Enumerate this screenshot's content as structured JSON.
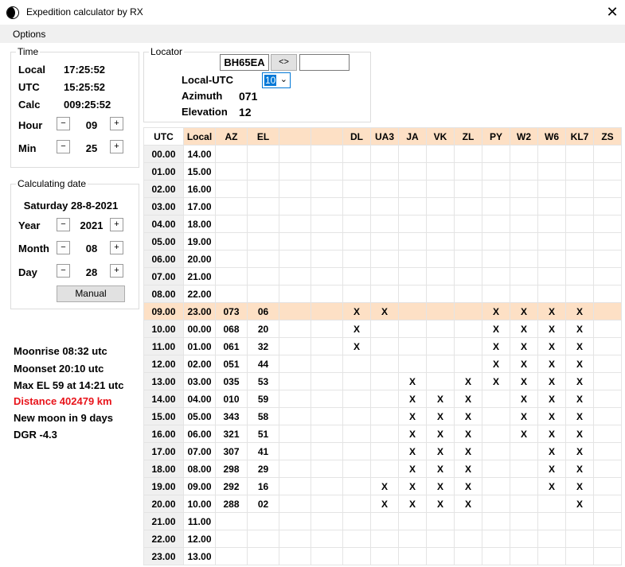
{
  "window": {
    "title": "Expedition calculator by RX",
    "close": "✕"
  },
  "menu": {
    "options": "Options"
  },
  "time": {
    "group_label": "Time",
    "local_label": "Local",
    "local_value": "17:25:52",
    "utc_label": "UTC",
    "utc_value": "15:25:52",
    "calc_label": "Calc",
    "calc_value": "009:25:52",
    "hour_label": "Hour",
    "hour_value": "09",
    "min_label": "Min",
    "min_value": "25"
  },
  "calc_date": {
    "group_label": "Calculating date",
    "date_text": "Saturday 28-8-2021",
    "year_label": "Year",
    "year_value": "2021",
    "month_label": "Month",
    "month_value": "08",
    "day_label": "Day",
    "day_value": "28",
    "manual_button": "Manual"
  },
  "stepper": {
    "minus": "−",
    "plus": "+"
  },
  "locator": {
    "group_label": "Locator",
    "value": "BH65EA",
    "swap_button": "<>",
    "second_value": "",
    "local_utc_label": "Local-UTC",
    "local_utc_value": "10",
    "azimuth_label": "Azimuth",
    "azimuth_value": "071",
    "elevation_label": "Elevation",
    "elevation_value": "12"
  },
  "moon_info": {
    "moonrise": "Moonrise 08:32 utc",
    "moonset": "Moonset 20:10 utc",
    "max_el": "Max EL 59 at 14:21 utc",
    "distance": "Distance 402479 km",
    "new_moon": "New moon in 9 days",
    "dgr": "DGR -4.3"
  },
  "colors": {
    "highlight": "#fde0c5",
    "distance": "#e8141b",
    "select_accent": "#0078d7"
  },
  "table": {
    "headers": [
      "UTC",
      "Local",
      "AZ",
      "EL",
      "",
      "",
      "DL",
      "UA3",
      "JA",
      "VK",
      "ZL",
      "PY",
      "W2",
      "W6",
      "KL7",
      "ZS"
    ],
    "highlight_row": 9,
    "rows": [
      [
        "00.00",
        "14.00",
        "",
        "",
        "",
        "",
        "",
        "",
        "",
        "",
        "",
        "",
        "",
        "",
        "",
        ""
      ],
      [
        "01.00",
        "15.00",
        "",
        "",
        "",
        "",
        "",
        "",
        "",
        "",
        "",
        "",
        "",
        "",
        "",
        ""
      ],
      [
        "02.00",
        "16.00",
        "",
        "",
        "",
        "",
        "",
        "",
        "",
        "",
        "",
        "",
        "",
        "",
        "",
        ""
      ],
      [
        "03.00",
        "17.00",
        "",
        "",
        "",
        "",
        "",
        "",
        "",
        "",
        "",
        "",
        "",
        "",
        "",
        ""
      ],
      [
        "04.00",
        "18.00",
        "",
        "",
        "",
        "",
        "",
        "",
        "",
        "",
        "",
        "",
        "",
        "",
        "",
        ""
      ],
      [
        "05.00",
        "19.00",
        "",
        "",
        "",
        "",
        "",
        "",
        "",
        "",
        "",
        "",
        "",
        "",
        "",
        ""
      ],
      [
        "06.00",
        "20.00",
        "",
        "",
        "",
        "",
        "",
        "",
        "",
        "",
        "",
        "",
        "",
        "",
        "",
        ""
      ],
      [
        "07.00",
        "21.00",
        "",
        "",
        "",
        "",
        "",
        "",
        "",
        "",
        "",
        "",
        "",
        "",
        "",
        ""
      ],
      [
        "08.00",
        "22.00",
        "",
        "",
        "",
        "",
        "",
        "",
        "",
        "",
        "",
        "",
        "",
        "",
        "",
        ""
      ],
      [
        "09.00",
        "23.00",
        "073",
        "06",
        "",
        "",
        "X",
        "X",
        "",
        "",
        "",
        "X",
        "X",
        "X",
        "X",
        ""
      ],
      [
        "10.00",
        "00.00",
        "068",
        "20",
        "",
        "",
        "X",
        "",
        "",
        "",
        "",
        "X",
        "X",
        "X",
        "X",
        ""
      ],
      [
        "11.00",
        "01.00",
        "061",
        "32",
        "",
        "",
        "X",
        "",
        "",
        "",
        "",
        "X",
        "X",
        "X",
        "X",
        ""
      ],
      [
        "12.00",
        "02.00",
        "051",
        "44",
        "",
        "",
        "",
        "",
        "",
        "",
        "",
        "X",
        "X",
        "X",
        "X",
        ""
      ],
      [
        "13.00",
        "03.00",
        "035",
        "53",
        "",
        "",
        "",
        "",
        "X",
        "",
        "X",
        "X",
        "X",
        "X",
        "X",
        ""
      ],
      [
        "14.00",
        "04.00",
        "010",
        "59",
        "",
        "",
        "",
        "",
        "X",
        "X",
        "X",
        "",
        "X",
        "X",
        "X",
        ""
      ],
      [
        "15.00",
        "05.00",
        "343",
        "58",
        "",
        "",
        "",
        "",
        "X",
        "X",
        "X",
        "",
        "X",
        "X",
        "X",
        ""
      ],
      [
        "16.00",
        "06.00",
        "321",
        "51",
        "",
        "",
        "",
        "",
        "X",
        "X",
        "X",
        "",
        "X",
        "X",
        "X",
        ""
      ],
      [
        "17.00",
        "07.00",
        "307",
        "41",
        "",
        "",
        "",
        "",
        "X",
        "X",
        "X",
        "",
        "",
        "X",
        "X",
        ""
      ],
      [
        "18.00",
        "08.00",
        "298",
        "29",
        "",
        "",
        "",
        "",
        "X",
        "X",
        "X",
        "",
        "",
        "X",
        "X",
        ""
      ],
      [
        "19.00",
        "09.00",
        "292",
        "16",
        "",
        "",
        "",
        "X",
        "X",
        "X",
        "X",
        "",
        "",
        "X",
        "X",
        ""
      ],
      [
        "20.00",
        "10.00",
        "288",
        "02",
        "",
        "",
        "",
        "X",
        "X",
        "X",
        "X",
        "",
        "",
        "",
        "X",
        ""
      ],
      [
        "21.00",
        "11.00",
        "",
        "",
        "",
        "",
        "",
        "",
        "",
        "",
        "",
        "",
        "",
        "",
        "",
        ""
      ],
      [
        "22.00",
        "12.00",
        "",
        "",
        "",
        "",
        "",
        "",
        "",
        "",
        "",
        "",
        "",
        "",
        "",
        ""
      ],
      [
        "23.00",
        "13.00",
        "",
        "",
        "",
        "",
        "",
        "",
        "",
        "",
        "",
        "",
        "",
        "",
        "",
        ""
      ]
    ]
  }
}
